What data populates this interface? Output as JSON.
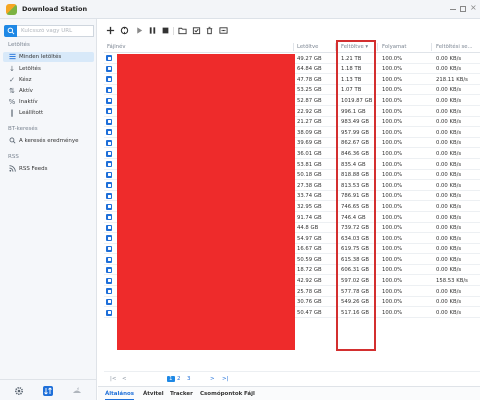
{
  "window": {
    "title": "Download Station"
  },
  "sidebar": {
    "search_placeholder": "Kulcsszó vagy URL",
    "section_downloads": "Letöltés",
    "items": [
      {
        "label": "Minden letöltés",
        "icon": "list-icon",
        "active": true
      },
      {
        "label": "Letöltés",
        "icon": "download-arrow-icon"
      },
      {
        "label": "Kész",
        "icon": "check-icon"
      },
      {
        "label": "Aktív",
        "icon": "updown-arrows-icon"
      },
      {
        "label": "Inaktív",
        "icon": "percent-icon"
      },
      {
        "label": "Leállított",
        "icon": "pause-icon"
      }
    ],
    "section_bt": "BT-keresés",
    "bt_items": [
      {
        "label": "A keresés eredménye",
        "icon": "search-icon"
      }
    ],
    "section_rss": "RSS",
    "rss_items": [
      {
        "label": "RSS Feeds",
        "icon": "rss-icon"
      }
    ]
  },
  "table": {
    "headers": {
      "name": "Fájlnév",
      "downloaded": "Letöltve",
      "uploaded": "Feltöltve",
      "progress": "Folyamat",
      "upload_speed": "Feltöltési se..."
    },
    "rows": [
      [
        "49.27 GB",
        "1.21 TB",
        "100.0%",
        "0.00 KB/s"
      ],
      [
        "64.84 GB",
        "1.18 TB",
        "100.0%",
        "0.00 KB/s"
      ],
      [
        "47.78 GB",
        "1.13 TB",
        "100.0%",
        "218.11 KB/s"
      ],
      [
        "53.25 GB",
        "1.07 TB",
        "100.0%",
        "0.00 KB/s"
      ],
      [
        "52.87 GB",
        "1019.87 GB",
        "100.0%",
        "0.00 KB/s"
      ],
      [
        "22.92 GB",
        "996.1 GB",
        "100.0%",
        "0.00 KB/s"
      ],
      [
        "21.27 GB",
        "983.49 GB",
        "100.0%",
        "0.00 KB/s"
      ],
      [
        "38.09 GB",
        "957.99 GB",
        "100.0%",
        "0.00 KB/s"
      ],
      [
        "39.69 GB",
        "862.67 GB",
        "100.0%",
        "0.00 KB/s"
      ],
      [
        "36.01 GB",
        "846.36 GB",
        "100.0%",
        "0.00 KB/s"
      ],
      [
        "53.81 GB",
        "835.4 GB",
        "100.0%",
        "0.00 KB/s"
      ],
      [
        "50.18 GB",
        "818.88 GB",
        "100.0%",
        "0.00 KB/s"
      ],
      [
        "27.38 GB",
        "813.53 GB",
        "100.0%",
        "0.00 KB/s"
      ],
      [
        "33.74 GB",
        "786.91 GB",
        "100.0%",
        "0.00 KB/s"
      ],
      [
        "32.95 GB",
        "746.65 GB",
        "100.0%",
        "0.00 KB/s"
      ],
      [
        "91.74 GB",
        "746.4 GB",
        "100.0%",
        "0.00 KB/s"
      ],
      [
        "44.8 GB",
        "739.72 GB",
        "100.0%",
        "0.00 KB/s"
      ],
      [
        "54.97 GB",
        "634.03 GB",
        "100.0%",
        "0.00 KB/s"
      ],
      [
        "16.67 GB",
        "619.75 GB",
        "100.0%",
        "0.00 KB/s"
      ],
      [
        "50.59 GB",
        "615.38 GB",
        "100.0%",
        "0.00 KB/s"
      ],
      [
        "18.72 GB",
        "606.31 GB",
        "100.0%",
        "0.00 KB/s"
      ],
      [
        "42.92 GB",
        "597.02 GB",
        "100.0%",
        "158.53 KB/s"
      ],
      [
        "25.78 GB",
        "577.78 GB",
        "100.0%",
        "0.00 KB/s"
      ],
      [
        "30.76 GB",
        "549.26 GB",
        "100.0%",
        "0.00 KB/s"
      ],
      [
        "50.47 GB",
        "517.16 GB",
        "100.0%",
        "0.00 KB/s"
      ]
    ]
  },
  "pager": {
    "first": "|<",
    "prev": "<",
    "pages": [
      "1",
      "2",
      "3"
    ],
    "next": ">",
    "last": ">|"
  },
  "tabs": [
    "Általános",
    "Átvitel",
    "Tracker",
    "Csomópontok",
    "Fájl"
  ],
  "colors": {
    "accent": "#1e88e5",
    "highlight": "#d32f2f",
    "redaction": "#ee2b2b"
  }
}
